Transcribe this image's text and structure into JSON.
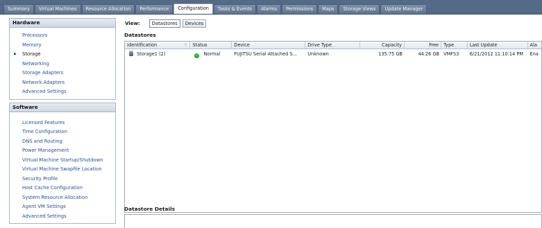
{
  "tabs": [
    {
      "label": "Summary",
      "active": false
    },
    {
      "label": "Virtual Machines",
      "active": false
    },
    {
      "label": "Resource Allocation",
      "active": false
    },
    {
      "label": "Performance",
      "active": false
    },
    {
      "label": "Configuration",
      "active": true
    },
    {
      "label": "Tasks & Events",
      "active": false
    },
    {
      "label": "Alarms",
      "active": false
    },
    {
      "label": "Permissions",
      "active": false
    },
    {
      "label": "Maps",
      "active": false
    },
    {
      "label": "Storage Views",
      "active": false
    },
    {
      "label": "Update Manager",
      "active": false
    }
  ],
  "hardware": {
    "title": "Hardware",
    "items": [
      {
        "label": "Processors"
      },
      {
        "label": "Memory"
      },
      {
        "label": "Storage",
        "selected": true
      },
      {
        "label": "Networking"
      },
      {
        "label": "Storage Adapters"
      },
      {
        "label": "Network Adapters"
      },
      {
        "label": "Advanced Settings"
      }
    ]
  },
  "software": {
    "title": "Software",
    "items": [
      {
        "label": "Licensed Features"
      },
      {
        "label": "Time Configuration"
      },
      {
        "label": "DNS and Routing"
      },
      {
        "label": "Power Management"
      },
      {
        "label": "Virtual Machine Startup/Shutdown"
      },
      {
        "label": "Virtual Machine Swapfile Location"
      },
      {
        "label": "Security Profile"
      },
      {
        "label": "Host Cache Configuration"
      },
      {
        "label": "System Resource Allocation"
      },
      {
        "label": "Agent VM Settings"
      },
      {
        "label": "Advanced Settings"
      }
    ]
  },
  "view": {
    "label": "View:",
    "buttons": [
      {
        "label": "Datastores",
        "active": true
      },
      {
        "label": "Devices",
        "active": false
      }
    ]
  },
  "datastores": {
    "title": "Datastores",
    "columns": [
      "Identification",
      "Status",
      "Device",
      "Drive Type",
      "Capacity",
      "Free",
      "Type",
      "Last Update",
      "Ala"
    ],
    "rows": [
      {
        "identification": "Storage1 (2)",
        "status": "Normal",
        "device": "FUJITSU Serial Attached S...",
        "drive_type": "Unknown",
        "capacity": "135.75 GB",
        "free": "44.26 GB",
        "type": "VMFS3",
        "last_update": "6/21/2012 11:10:14 PM",
        "alarm": "Ena"
      }
    ]
  },
  "details": {
    "title": "Datastore Details"
  }
}
